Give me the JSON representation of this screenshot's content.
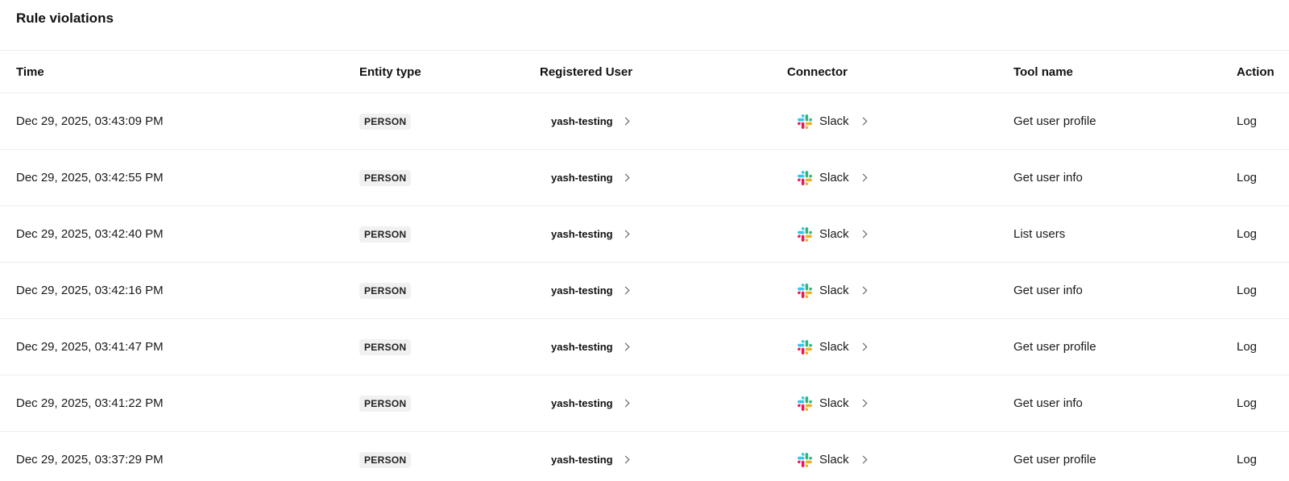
{
  "page": {
    "title": "Rule violations"
  },
  "table": {
    "headers": {
      "time": "Time",
      "entity_type": "Entity type",
      "registered_user": "Registered User",
      "connector": "Connector",
      "tool_name": "Tool name",
      "action": "Action"
    },
    "rows": [
      {
        "time": "Dec 29, 2025, 03:43:09 PM",
        "entity_type": "PERSON",
        "registered_user": "yash-testing",
        "connector": "Slack",
        "tool_name": "Get user profile",
        "action": "Log"
      },
      {
        "time": "Dec 29, 2025, 03:42:55 PM",
        "entity_type": "PERSON",
        "registered_user": "yash-testing",
        "connector": "Slack",
        "tool_name": "Get user info",
        "action": "Log"
      },
      {
        "time": "Dec 29, 2025, 03:42:40 PM",
        "entity_type": "PERSON",
        "registered_user": "yash-testing",
        "connector": "Slack",
        "tool_name": "List users",
        "action": "Log"
      },
      {
        "time": "Dec 29, 2025, 03:42:16 PM",
        "entity_type": "PERSON",
        "registered_user": "yash-testing",
        "connector": "Slack",
        "tool_name": "Get user info",
        "action": "Log"
      },
      {
        "time": "Dec 29, 2025, 03:41:47 PM",
        "entity_type": "PERSON",
        "registered_user": "yash-testing",
        "connector": "Slack",
        "tool_name": "Get user profile",
        "action": "Log"
      },
      {
        "time": "Dec 29, 2025, 03:41:22 PM",
        "entity_type": "PERSON",
        "registered_user": "yash-testing",
        "connector": "Slack",
        "tool_name": "Get user info",
        "action": "Log"
      },
      {
        "time": "Dec 29, 2025, 03:37:29 PM",
        "entity_type": "PERSON",
        "registered_user": "yash-testing",
        "connector": "Slack",
        "tool_name": "Get user profile",
        "action": "Log"
      }
    ]
  },
  "icons": {
    "connector_icon": "slack-icon",
    "link_icon": "chevron-right-icon"
  },
  "colors": {
    "slack_blue": "#36C5F0",
    "slack_green": "#2EB67D",
    "slack_yellow": "#ECB22E",
    "slack_red": "#E01E5A",
    "badge_bg": "#f1f1f1",
    "divider": "#eeeeee"
  }
}
